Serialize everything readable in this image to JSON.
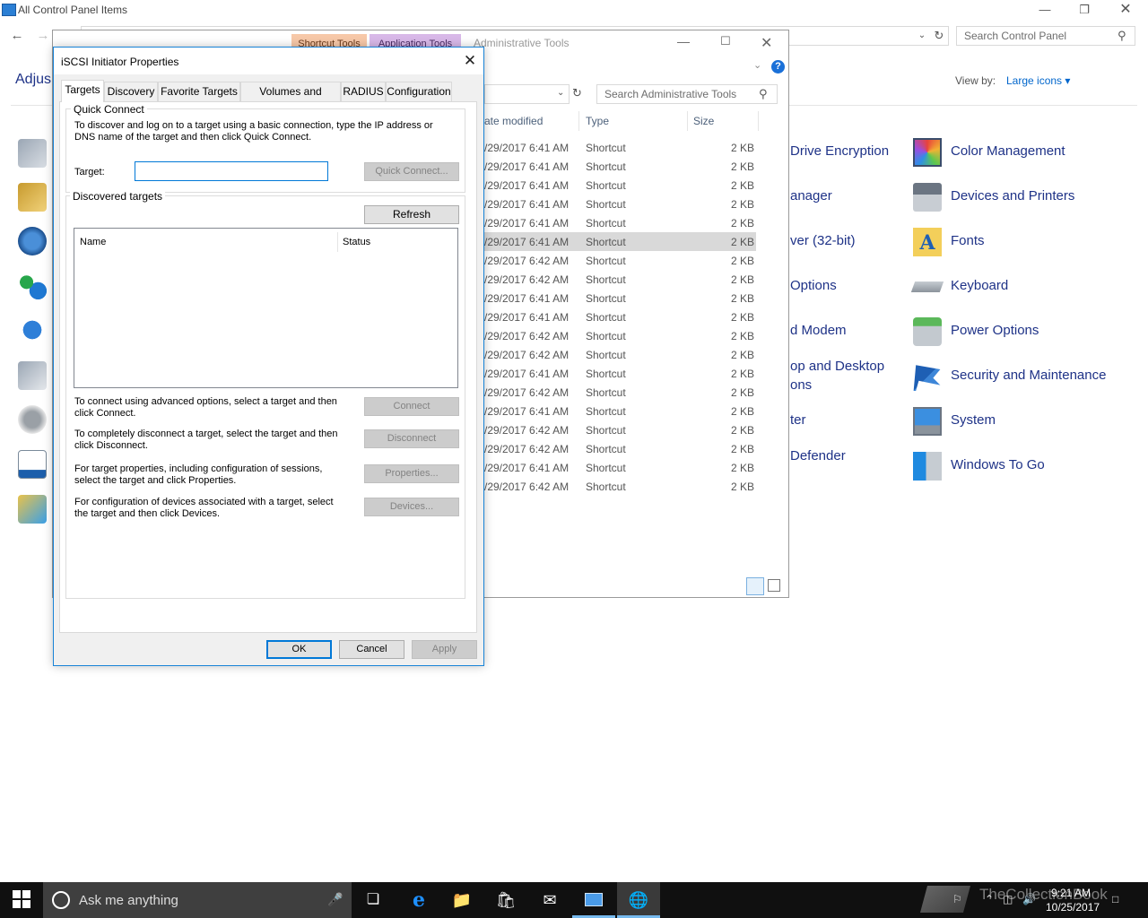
{
  "control_panel": {
    "title": "All Control Panel Items",
    "heading": "Adjus",
    "search_placeholder": "Search Control Panel",
    "view_by_label": "View by:",
    "view_by_value": "Large icons",
    "items_right": [
      {
        "label": "Color Management",
        "icon": "color-management-icon"
      },
      {
        "label": "Devices and Printers",
        "icon": "devices-printers-icon"
      },
      {
        "label": "Fonts",
        "icon": "fonts-icon"
      },
      {
        "label": "Keyboard",
        "icon": "keyboard-icon"
      },
      {
        "label": "Power Options",
        "icon": "power-options-icon"
      },
      {
        "label": "Security and Maintenance",
        "icon": "security-flag-icon"
      },
      {
        "label": "System",
        "icon": "system-icon"
      },
      {
        "label": "Windows To Go",
        "icon": "windows-to-go-icon"
      }
    ],
    "items_partial": [
      "Drive Encryption",
      "anager",
      "ver (32-bit)",
      "Options",
      "d Modem",
      "op and Desktop",
      "ons",
      "ter",
      "Defender"
    ]
  },
  "admin_tools": {
    "title": "Administrative Tools",
    "ribbon_tab_shortcut": "Shortcut Tools",
    "ribbon_tab_app": "Application Tools",
    "search_placeholder": "Search Administrative Tools",
    "columns": {
      "date": "ate modified",
      "type": "Type",
      "size": "Size"
    },
    "rows": [
      {
        "date": "/29/2017 6:41 AM",
        "type": "Shortcut",
        "size": "2 KB"
      },
      {
        "date": "/29/2017 6:41 AM",
        "type": "Shortcut",
        "size": "2 KB"
      },
      {
        "date": "/29/2017 6:41 AM",
        "type": "Shortcut",
        "size": "2 KB"
      },
      {
        "date": "/29/2017 6:41 AM",
        "type": "Shortcut",
        "size": "2 KB"
      },
      {
        "date": "/29/2017 6:41 AM",
        "type": "Shortcut",
        "size": "2 KB"
      },
      {
        "date": "/29/2017 6:41 AM",
        "type": "Shortcut",
        "size": "2 KB"
      },
      {
        "date": "/29/2017 6:42 AM",
        "type": "Shortcut",
        "size": "2 KB"
      },
      {
        "date": "/29/2017 6:42 AM",
        "type": "Shortcut",
        "size": "2 KB"
      },
      {
        "date": "/29/2017 6:41 AM",
        "type": "Shortcut",
        "size": "2 KB"
      },
      {
        "date": "/29/2017 6:41 AM",
        "type": "Shortcut",
        "size": "2 KB"
      },
      {
        "date": "/29/2017 6:42 AM",
        "type": "Shortcut",
        "size": "2 KB"
      },
      {
        "date": "/29/2017 6:42 AM",
        "type": "Shortcut",
        "size": "2 KB"
      },
      {
        "date": "/29/2017 6:41 AM",
        "type": "Shortcut",
        "size": "2 KB"
      },
      {
        "date": "/29/2017 6:42 AM",
        "type": "Shortcut",
        "size": "2 KB"
      },
      {
        "date": "/29/2017 6:41 AM",
        "type": "Shortcut",
        "size": "2 KB"
      },
      {
        "date": "/29/2017 6:42 AM",
        "type": "Shortcut",
        "size": "2 KB"
      },
      {
        "date": "/29/2017 6:42 AM",
        "type": "Shortcut",
        "size": "2 KB"
      },
      {
        "date": "/29/2017 6:41 AM",
        "type": "Shortcut",
        "size": "2 KB"
      },
      {
        "date": "/29/2017 6:42 AM",
        "type": "Shortcut",
        "size": "2 KB"
      }
    ]
  },
  "dialog": {
    "title": "iSCSI Initiator Properties",
    "tabs": [
      "Targets",
      "Discovery",
      "Favorite Targets",
      "Volumes and Devices",
      "RADIUS",
      "Configuration"
    ],
    "quick_connect": {
      "group_title": "Quick Connect",
      "description": "To discover and log on to a target using a basic connection, type the IP address or DNS name of the target and then click Quick Connect.",
      "target_label": "Target:",
      "target_value": "",
      "button": "Quick Connect..."
    },
    "discovered": {
      "group_title": "Discovered targets",
      "refresh_button": "Refresh",
      "col_name": "Name",
      "col_status": "Status"
    },
    "actions": [
      {
        "text": "To connect using advanced options, select a target and then click Connect.",
        "button": "Connect"
      },
      {
        "text": "To completely disconnect a target, select the target and then click Disconnect.",
        "button": "Disconnect"
      },
      {
        "text": "For target properties, including configuration of sessions, select the target and click Properties.",
        "button": "Properties..."
      },
      {
        "text": "For configuration of devices associated with a target, select the target and then click Devices.",
        "button": "Devices..."
      }
    ],
    "ok": "OK",
    "cancel": "Cancel",
    "apply": "Apply"
  },
  "taskbar": {
    "search_text": "Ask me anything",
    "time": "9:21 AM",
    "date": "10/25/2017",
    "watermark": "TheCollectionBook",
    "accent": "#76b9ed"
  }
}
